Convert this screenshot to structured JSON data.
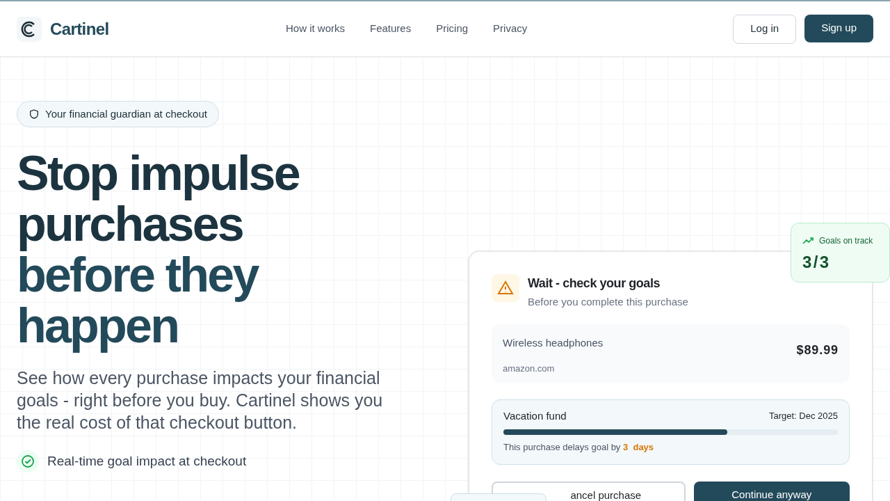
{
  "nav": {
    "brand": "Cartinel",
    "links": [
      "How it works",
      "Features",
      "Pricing",
      "Privacy"
    ],
    "login": "Log in",
    "signup": "Sign up"
  },
  "hero": {
    "badge": "Your financial guardian at checkout",
    "title": "Stop impulse purchases",
    "title_accent": "before they happen",
    "subtitle": "See how every purchase impacts your financial goals - right before you buy. Cartinel shows you the real cost of that checkout button.",
    "features": [
      "Real-time goal impact at checkout"
    ]
  },
  "card": {
    "title": "Wait - check your goals",
    "subtitle": "Before you complete this purchase",
    "item": "Wireless headphones",
    "store": "amazon.com",
    "price": "$89.99",
    "goal": {
      "name": "Vacation fund",
      "target": "Target: Dec 2025",
      "level": 0.67,
      "delay_prefix": "This purchase delays goal by",
      "delay_value": "3  days"
    },
    "cancel": "ancel purchase",
    "continue": "Continue anyway"
  },
  "tracker": {
    "label": "Goals on track",
    "value": "3/3"
  }
}
